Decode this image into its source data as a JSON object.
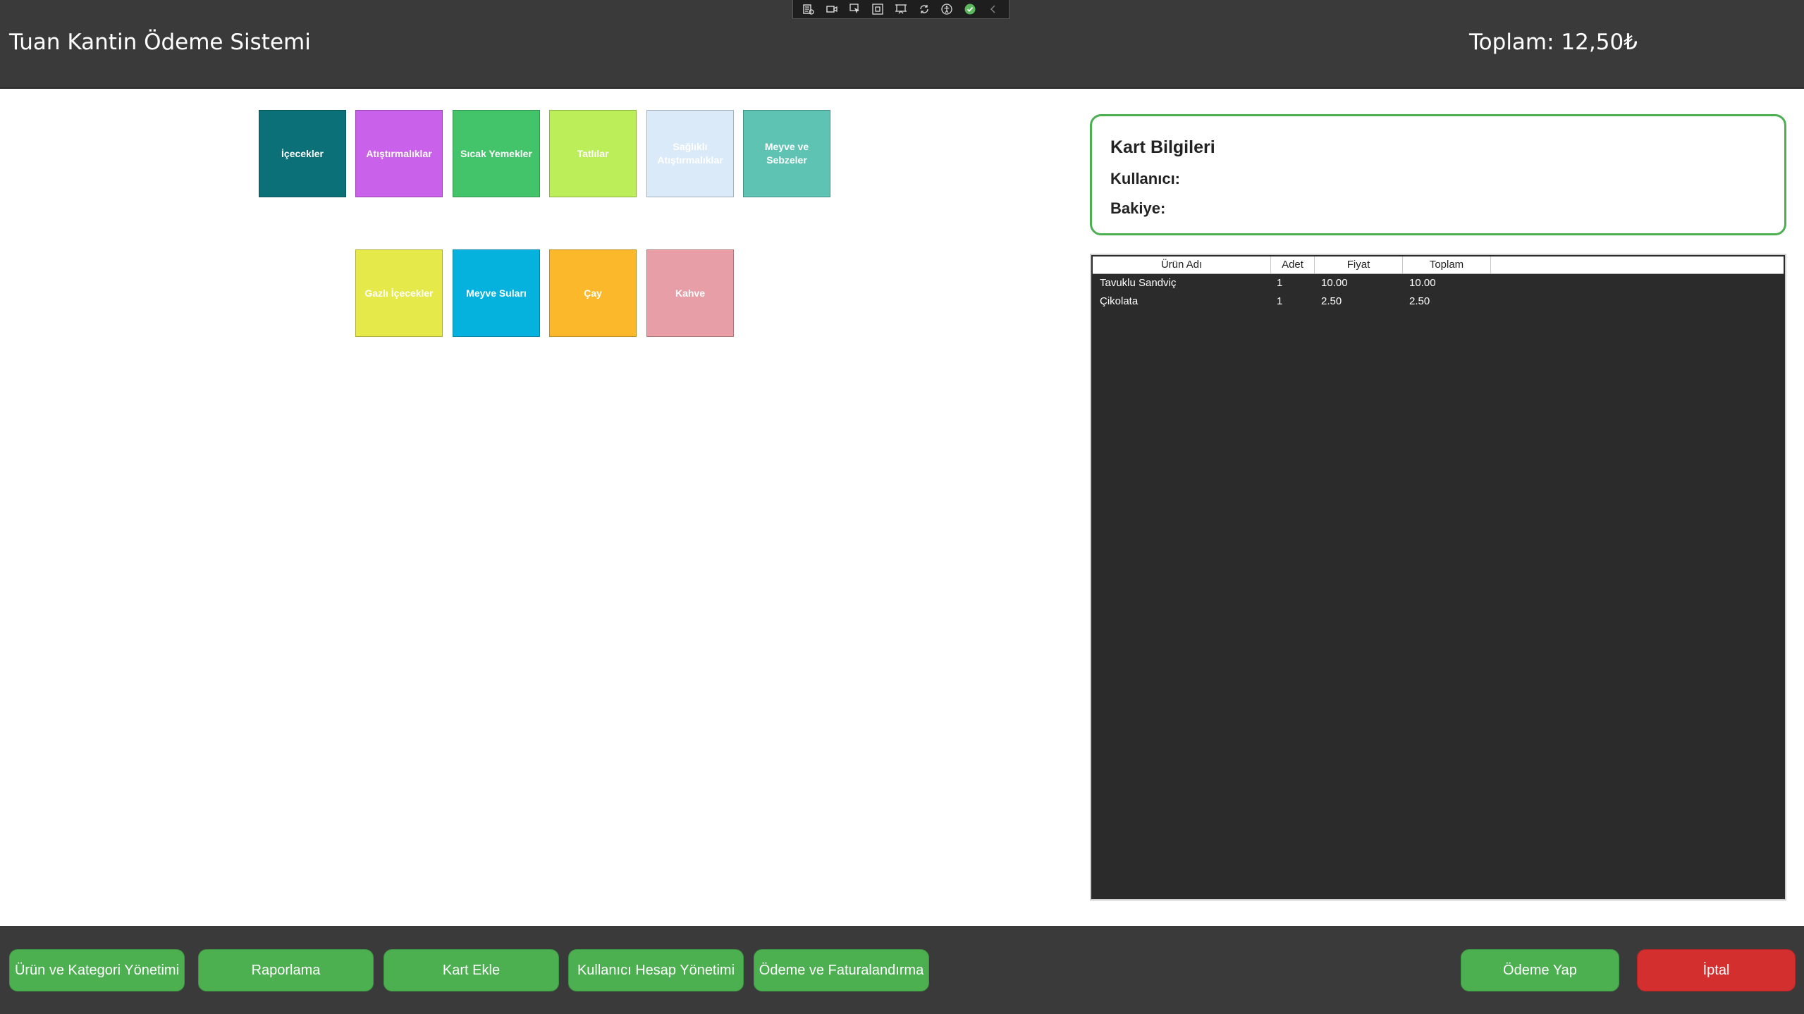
{
  "app": {
    "title": "Tuan Kantin Ödeme Sistemi",
    "total": "Toplam: 12,50₺"
  },
  "debug_toolbar": {
    "icons": [
      "live-visual-tree-icon",
      "video-icon",
      "select-element-icon",
      "display-adorners-icon",
      "track-focus-icon",
      "hot-reload-icon",
      "accessibility-icon",
      "checkmark-icon",
      "collapse-chevron-icon"
    ]
  },
  "categories": {
    "row1": [
      {
        "label": "İçecekler",
        "color": "#0b7077"
      },
      {
        "label": "Atıştırmalıklar",
        "color": "#c961eb"
      },
      {
        "label": "Sıcak Yemekler",
        "color": "#44c46a"
      },
      {
        "label": "Tatlılar",
        "color": "#bcee5a"
      },
      {
        "label": "Sağlıklı Atıştırmalıklar",
        "color": "#dbeaf8"
      },
      {
        "label": "Meyve ve Sebzeler",
        "color": "#5ec3b3"
      }
    ],
    "row2": [
      {
        "label": "Gazlı İçecekler",
        "color": "#e5e94a"
      },
      {
        "label": "Meyve Suları",
        "color": "#04b2dd"
      },
      {
        "label": "Çay",
        "color": "#fbb82a"
      },
      {
        "label": "Kahve",
        "color": "#e79ea6"
      }
    ]
  },
  "card_info": {
    "title": "Kart Bilgileri",
    "user_label": "Kullanıcı:",
    "balance_label": "Bakiye:"
  },
  "cart": {
    "columns": [
      "Ürün Adı",
      "Adet",
      "Fiyat",
      "Toplam"
    ],
    "rows": [
      [
        "Tavuklu Sandviç",
        "1",
        "10.00",
        "10.00"
      ],
      [
        "Çikolata",
        "1",
        "2.50",
        "2.50"
      ]
    ]
  },
  "footer": {
    "product_category_mgmt": "Ürün ve Kategori Yönetimi",
    "reporting": "Raporlama",
    "add_card": "Kart Ekle",
    "user_account_mgmt": "Kullanıcı Hesap Yönetimi",
    "payment_billing": "Ödeme ve Faturalandırma",
    "pay": "Ödeme Yap",
    "cancel": "İptal"
  },
  "colors": {
    "header_bg": "#3a3a3a",
    "accent_green": "#4caf50",
    "cancel_red": "#d32f2f",
    "grid_bg": "#2b2b2b"
  }
}
